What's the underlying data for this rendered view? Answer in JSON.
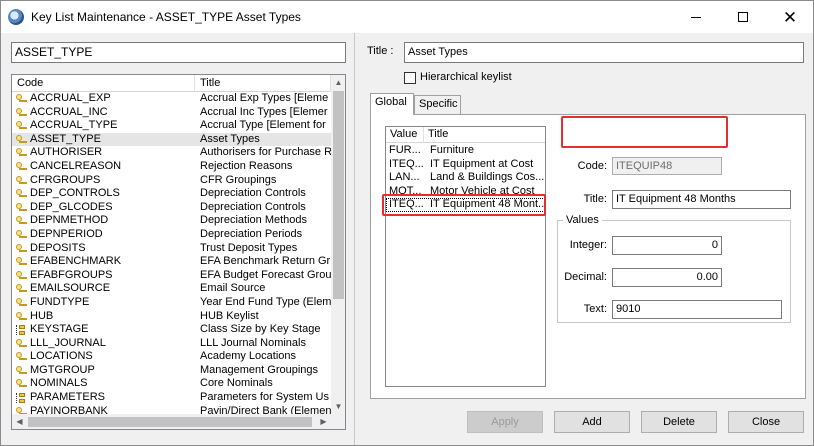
{
  "window": {
    "title": "Key List Maintenance - ASSET_TYPE Asset Types",
    "close_glyph": "✕"
  },
  "key_search": {
    "value": "ASSET_TYPE"
  },
  "key_list": {
    "columns": [
      "Code",
      "Title"
    ],
    "selected_index": 3,
    "rows": [
      {
        "code": "ACCRUAL_EXP",
        "title": "Accrual Exp Types [Eleme",
        "icon": "key-icon"
      },
      {
        "code": "ACCRUAL_INC",
        "title": "Accrual Inc Types [Elemer",
        "icon": "key-icon"
      },
      {
        "code": "ACCRUAL_TYPE",
        "title": "Accrual Type [Element for",
        "icon": "key-icon"
      },
      {
        "code": "ASSET_TYPE",
        "title": "Asset Types",
        "icon": "key-icon"
      },
      {
        "code": "AUTHORISER",
        "title": "Authorisers for Purchase R",
        "icon": "key-icon"
      },
      {
        "code": "CANCELREASON",
        "title": "Rejection Reasons",
        "icon": "key-icon"
      },
      {
        "code": "CFRGROUPS",
        "title": "CFR Groupings",
        "icon": "key-icon"
      },
      {
        "code": "DEP_CONTROLS",
        "title": "Depreciation Controls",
        "icon": "key-icon"
      },
      {
        "code": "DEP_GLCODES",
        "title": "Depreciation Controls",
        "icon": "key-icon"
      },
      {
        "code": "DEPNMETHOD",
        "title": "Depreciation Methods",
        "icon": "key-icon"
      },
      {
        "code": "DEPNPERIOD",
        "title": "Depreciation Periods",
        "icon": "key-icon"
      },
      {
        "code": "DEPOSITS",
        "title": "Trust Deposit Types",
        "icon": "key-icon"
      },
      {
        "code": "EFABENCHMARK",
        "title": "EFA Benchmark Return Gr",
        "icon": "key-icon"
      },
      {
        "code": "EFABFGROUPS",
        "title": "EFA Budget Forecast Grou",
        "icon": "key-icon"
      },
      {
        "code": "EMAILSOURCE",
        "title": "Email Source",
        "icon": "key-icon"
      },
      {
        "code": "FUNDTYPE",
        "title": "Year End Fund Type (Elem",
        "icon": "key-icon"
      },
      {
        "code": "HUB",
        "title": "HUB Keylist",
        "icon": "key-icon"
      },
      {
        "code": "KEYSTAGE",
        "title": "Class Size by Key Stage",
        "icon": "tree-icon"
      },
      {
        "code": "LLL_JOURNAL",
        "title": "LLL Journal Nominals",
        "icon": "key-icon"
      },
      {
        "code": "LOCATIONS",
        "title": "Academy Locations",
        "icon": "key-icon"
      },
      {
        "code": "MGTGROUP",
        "title": "Management Groupings",
        "icon": "key-icon"
      },
      {
        "code": "NOMINALS",
        "title": "Core Nominals",
        "icon": "key-icon"
      },
      {
        "code": "PARAMETERS",
        "title": "Parameters for System Us",
        "icon": "tree-icon"
      },
      {
        "code": "PAYINORBANK",
        "title": "Payin/Direct Bank (Elemen",
        "icon": "key-icon"
      }
    ]
  },
  "title_field": {
    "label": "Title :",
    "value": "Asset Types"
  },
  "hierarchical": {
    "label": "Hierarchical keylist",
    "checked": false
  },
  "tabs": [
    {
      "label": "Global",
      "active": true
    },
    {
      "label": "Specific",
      "active": false
    }
  ],
  "value_list": {
    "columns": [
      "Value",
      "Title"
    ],
    "selected_index": 4,
    "rows": [
      {
        "value": "FUR...",
        "title": "Furniture"
      },
      {
        "value": "ITEQ...",
        "title": "IT Equipment at Cost"
      },
      {
        "value": "LAN...",
        "title": "Land & Buildings Cos..."
      },
      {
        "value": "MOT...",
        "title": "Motor Vehicle at Cost"
      },
      {
        "value": "ITEQ...",
        "title": "IT Equipment 48 Mont..."
      }
    ]
  },
  "detail": {
    "code_label": "Code:",
    "code_value": "ITEQUIP48",
    "title_label": "Title:",
    "title_value": "IT Equipment 48 Months",
    "values_group": "Values",
    "integer_label": "Integer:",
    "integer_value": "0",
    "decimal_label": "Decimal:",
    "decimal_value": "0.00",
    "text_label": "Text:",
    "text_value": "9010"
  },
  "buttons": {
    "apply": "Apply",
    "add": "Add",
    "delete": "Delete",
    "close": "Close"
  },
  "colors": {
    "highlight_box": "#e03030",
    "selected_row": "#e5e5e5"
  }
}
